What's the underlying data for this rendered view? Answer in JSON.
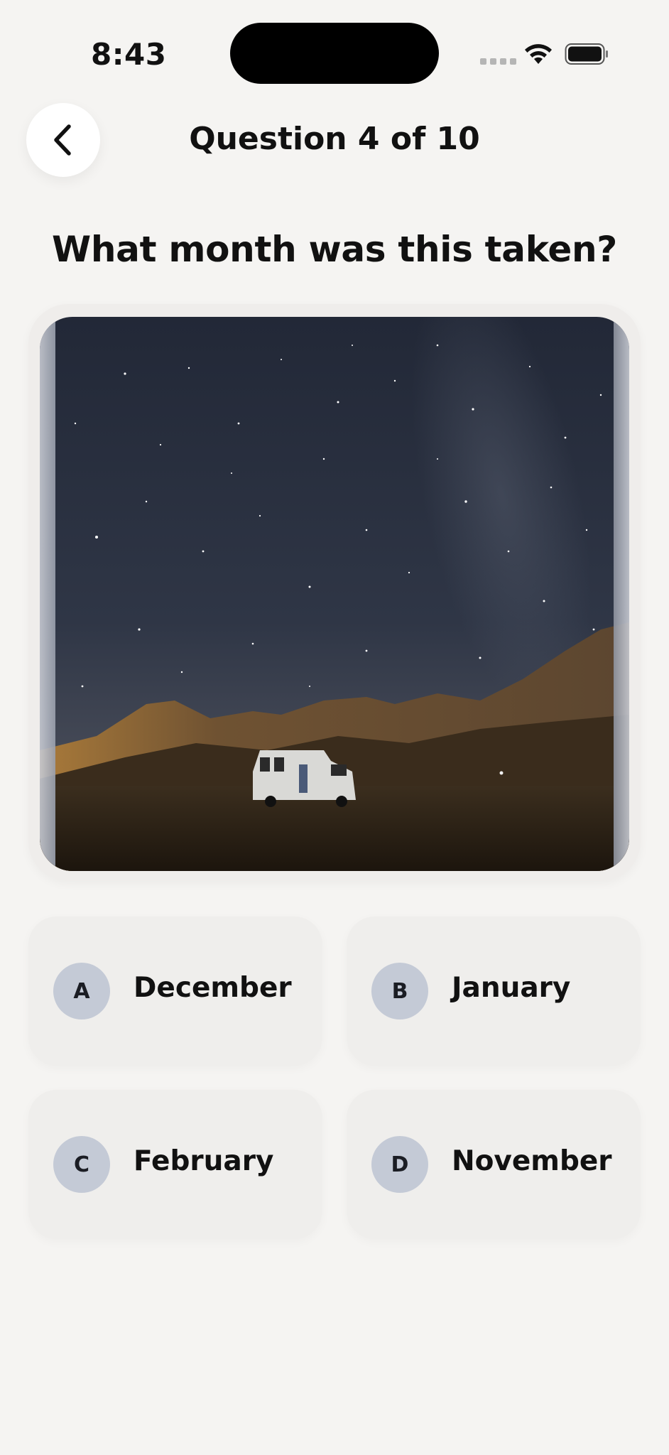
{
  "status_bar": {
    "time": "8:43"
  },
  "header": {
    "title": "Question 4 of 10",
    "back_icon": "chevron-left-icon"
  },
  "question": {
    "text": "What month was this taken?",
    "image": "night-sky-campervan-photo"
  },
  "answers": [
    {
      "letter": "A",
      "label": "December"
    },
    {
      "letter": "B",
      "label": "January"
    },
    {
      "letter": "C",
      "label": "February"
    },
    {
      "letter": "D",
      "label": "November"
    }
  ],
  "colors": {
    "background": "#f5f4f2",
    "card": "#efeeec",
    "letter_badge": "#c4cad6",
    "text": "#111111"
  }
}
